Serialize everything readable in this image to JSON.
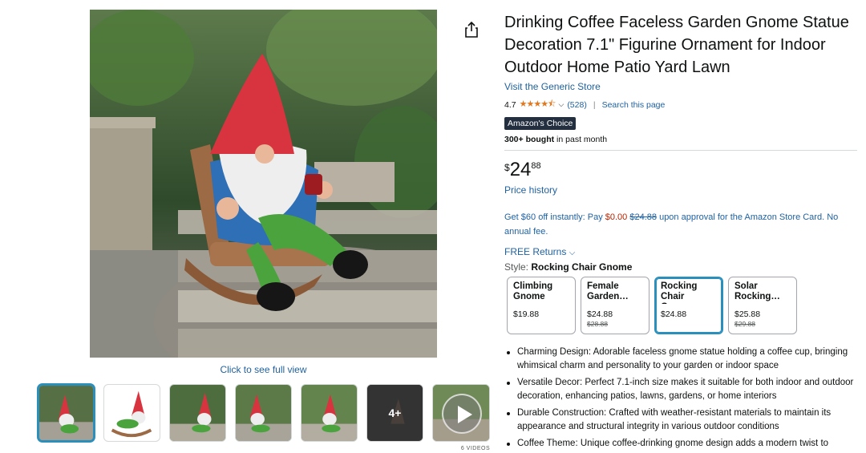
{
  "product": {
    "title": "Drinking Coffee Faceless Garden Gnome Statue Decoration 7.1\" Figurine Ornament for Indoor Outdoor Home Patio Yard Lawn",
    "store_link": "Visit the Generic Store",
    "rating_value": "4.7",
    "rating_stars": "★★★★⯪",
    "rating_count": "(528)",
    "search_page": "Search this page",
    "badge": "Amazon's Choice",
    "bought_bold": "300+ bought",
    "bought_rest": " in past month"
  },
  "price": {
    "symbol": "$",
    "whole": "24",
    "fraction": "88",
    "history_link": "Price history"
  },
  "promo": {
    "part1": "Get $60 off instantly: Pay ",
    "zero": "$0.00",
    "strike": "$24.88",
    "part2": " upon approval for the Amazon Store Card. No annual fee."
  },
  "returns": {
    "label": "FREE Returns",
    "chevron": "⌵"
  },
  "style": {
    "prefix": "Style: ",
    "selected": "Rocking Chair Gnome"
  },
  "swatches": [
    {
      "name": "Climbing Gnome",
      "price": "$19.88",
      "list": ""
    },
    {
      "name": "Female Garden…",
      "price": "$24.88",
      "list": "$28.88"
    },
    {
      "name": "Rocking Chair Gnome",
      "price": "$24.88",
      "list": ""
    },
    {
      "name": "Solar Rocking…",
      "price": "$25.88",
      "list": "$29.88"
    }
  ],
  "bullets": [
    "Charming Design: Adorable faceless gnome statue holding a coffee cup, bringing whimsical charm and personality to your garden or indoor space",
    "Versatile Decor: Perfect 7.1-inch size makes it suitable for both indoor and outdoor decoration, enhancing patios, lawns, gardens, or home interiors",
    "Durable Construction: Crafted with weather-resistant materials to maintain its appearance and structural integrity in various outdoor conditions",
    "Coffee Theme: Unique coffee-drinking gnome design adds a modern twist to"
  ],
  "gallery": {
    "full_view": "Click to see full view",
    "more_label": "4+",
    "videos_label": "6 VIDEOS"
  },
  "colors": {
    "link": "#2162a1",
    "star": "#de7921",
    "badge_bg": "#232f3e",
    "selected_border": "#2a8fbd",
    "deal_red": "#b12704"
  }
}
